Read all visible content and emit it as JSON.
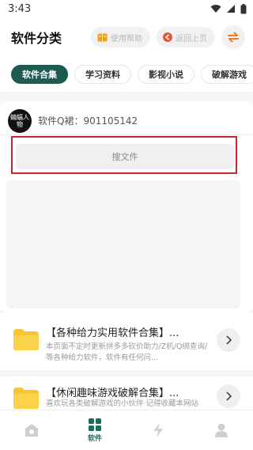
{
  "status_bar": {
    "time": "3:43"
  },
  "header": {
    "title": "软件分类",
    "help_label": "使用帮助",
    "back_label": "返回上页"
  },
  "tabs": [
    {
      "label": "软件合集",
      "active": true
    },
    {
      "label": "学习资料",
      "active": false
    },
    {
      "label": "影视小说",
      "active": false
    },
    {
      "label": "破解游戏",
      "active": false
    }
  ],
  "card": {
    "avatar_text": "蝙蝠人物",
    "qq_group": "软件Q裙：901105142",
    "search_placeholder": "搜文件"
  },
  "list": [
    {
      "title": "【各种给力实用软件合集】...",
      "desc": "本页面不定时更新拼多多砍价助力/Z机/Q绑查询/等各种给力软件，软件有任何问..."
    },
    {
      "title": "【休闲趣味游戏破解合集】...",
      "desc": "喜欢玩各类破解游戏的小伙伴 记得收藏本网站"
    }
  ],
  "bottom_nav": {
    "active_label": "软件"
  },
  "colors": {
    "accent": "#1d5b52",
    "highlight_border": "#c0282d",
    "folder": "#f7c630"
  }
}
